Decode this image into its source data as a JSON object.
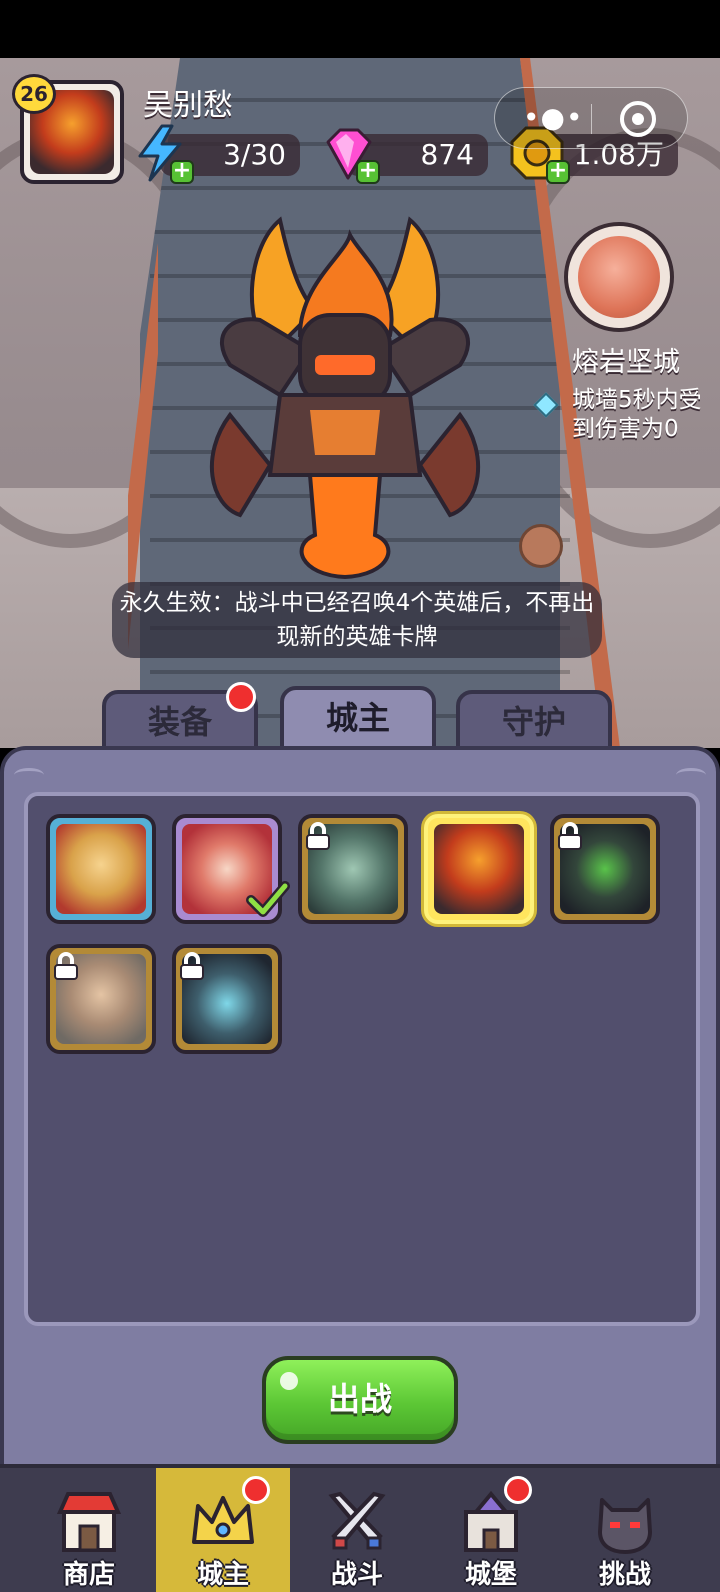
{
  "player": {
    "level": "26",
    "name": "吴别愁"
  },
  "resources": {
    "energy": "3/30",
    "gems": "874",
    "coins": "1.08万"
  },
  "hero": {
    "skill_name": "熔岩坚城",
    "skill_description": "城墙5秒内受到伤害为0",
    "permanent_effect": "永久生效：战斗中已经召唤4个英雄后，不再出现新的英雄卡牌"
  },
  "tabs": [
    {
      "label": "装备",
      "has_notification": true
    },
    {
      "label": "城主",
      "active": true
    },
    {
      "label": "守护"
    }
  ],
  "heroes": [
    {
      "name": "hero-blonde-knight",
      "frame": "blue",
      "locked": false
    },
    {
      "name": "hero-red-sorceress",
      "frame": "purple",
      "locked": false,
      "equipped": true
    },
    {
      "name": "hero-green-elf",
      "frame": "gold",
      "locked": true
    },
    {
      "name": "hero-lava-lord",
      "frame": "selected",
      "locked": false
    },
    {
      "name": "hero-dark-hunter",
      "frame": "gold",
      "locked": true
    },
    {
      "name": "hero-old-general",
      "frame": "gold",
      "locked": true
    },
    {
      "name": "hero-lich-king",
      "frame": "gold",
      "locked": true
    }
  ],
  "battle_button": "出战",
  "nav": [
    {
      "label": "商店",
      "icon": "shop-icon"
    },
    {
      "label": "城主",
      "icon": "crown-icon",
      "active": true,
      "has_notification": true
    },
    {
      "label": "战斗",
      "icon": "crossed-swords-icon"
    },
    {
      "label": "城堡",
      "icon": "castle-icon",
      "has_notification": true
    },
    {
      "label": "挑战",
      "icon": "demon-helmet-icon"
    }
  ],
  "colors": {
    "accent_green": "#5cc735",
    "nav_active": "#d6b93a",
    "notification_red": "#ef2f2f",
    "panel": "#7f7da2"
  }
}
